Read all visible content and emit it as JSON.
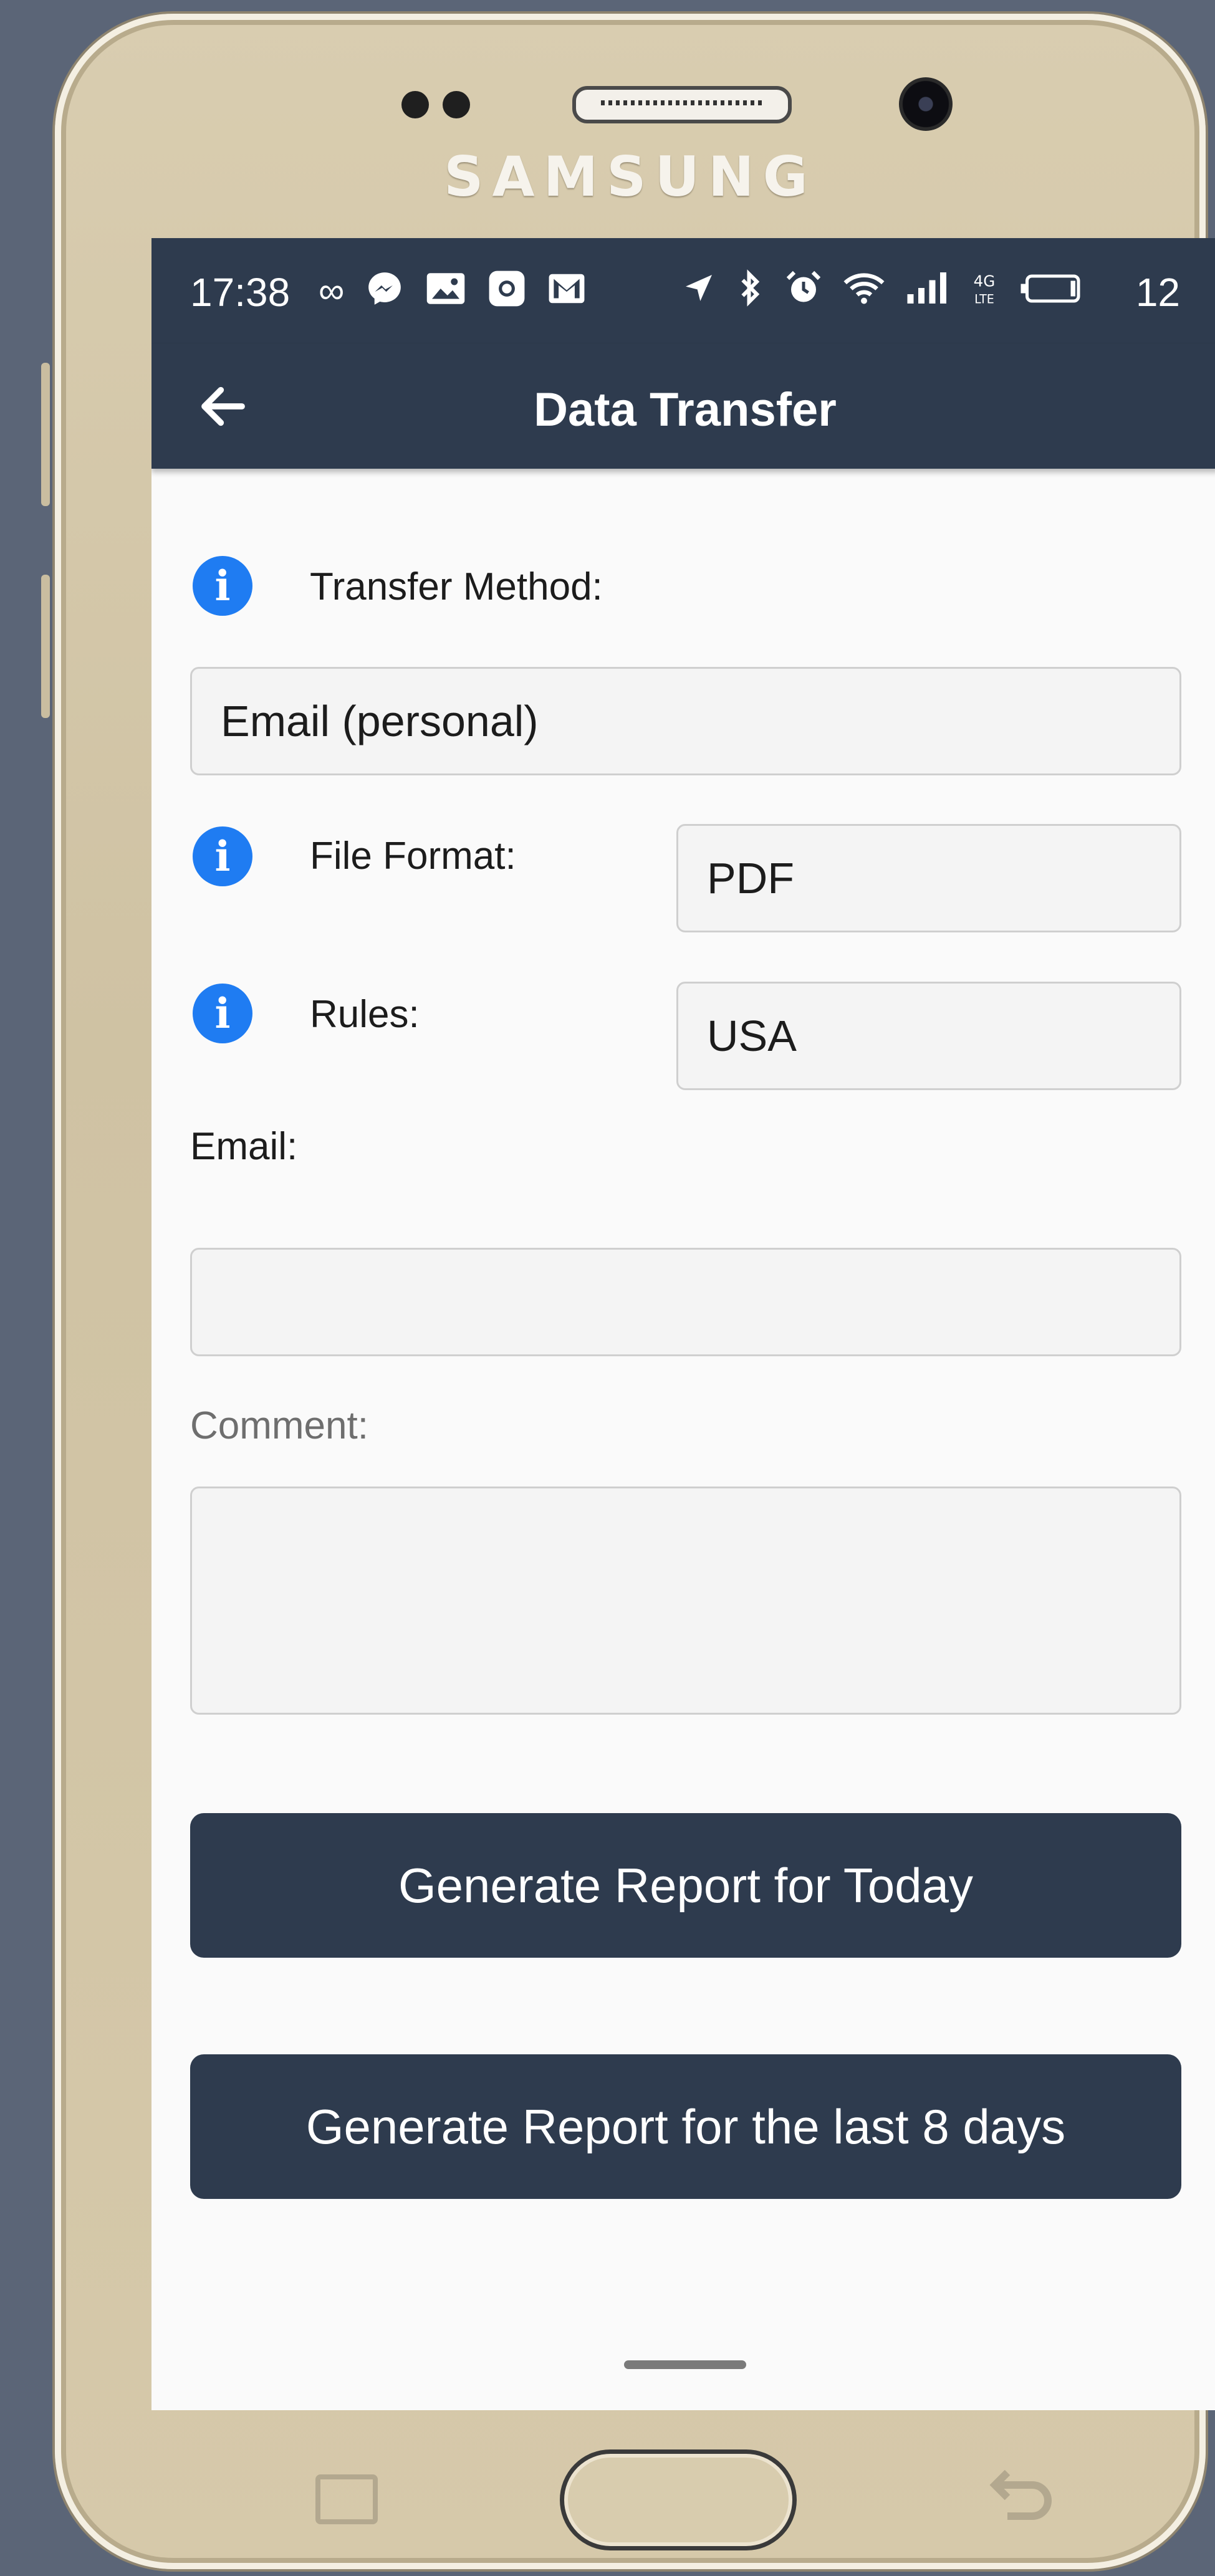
{
  "device": {
    "brand": "SAMSUNG"
  },
  "status_bar": {
    "time": "17:38",
    "left_icons": [
      "infinity-icon",
      "messenger-icon",
      "image-icon",
      "instagram-icon",
      "gmail-icon"
    ],
    "right_icons": [
      "location-arrow-icon",
      "bluetooth-icon",
      "alarm-icon",
      "wifi-icon",
      "signal-icon",
      "4g-lte-icon"
    ],
    "battery": "12"
  },
  "app_bar": {
    "title": "Data Transfer",
    "back_icon": "arrow-left-icon"
  },
  "form": {
    "transfer_method": {
      "label": "Transfer Method:",
      "value": "Email (personal)"
    },
    "file_format": {
      "label": "File Format:",
      "value": "PDF"
    },
    "rules": {
      "label": "Rules:",
      "value": "USA"
    },
    "email": {
      "label": "Email:",
      "value": ""
    },
    "comment": {
      "label": "Comment:",
      "value": ""
    }
  },
  "buttons": {
    "today": "Generate Report for Today",
    "last8": "Generate Report for the last 8 days"
  },
  "colors": {
    "primary": "#2e3b4e",
    "info": "#1f7cf2",
    "background": "#5b6577"
  }
}
